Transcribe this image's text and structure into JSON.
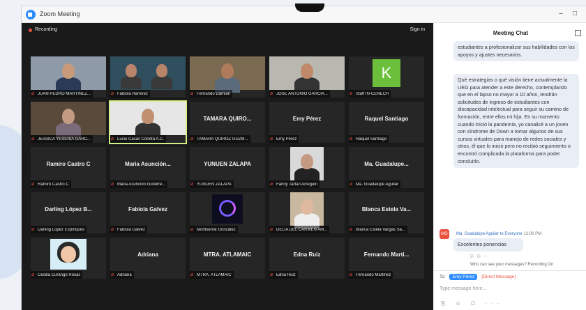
{
  "window": {
    "title": "Zoom Meeting",
    "minimize": "–",
    "maximize": "□"
  },
  "video": {
    "recording": "Recording",
    "sign_in": "Sign in"
  },
  "tiles": [
    {
      "label": "JUAN PEDRO MARTÍNEZ...",
      "kind": "photo",
      "skin": "#c99a7a",
      "bg": "#8e9aa8",
      "shirt": "#2b3a55"
    },
    {
      "label": "Fabiola Ramírez",
      "kind": "photo2",
      "skin": "#b9856a",
      "bg": "#2f4f5f",
      "shirt": "#3a3a3a"
    },
    {
      "label": "Fernando Damian",
      "kind": "photo",
      "skin": "#b07a5c",
      "bg": "#7a6a52",
      "shirt": "#5b6b7b"
    },
    {
      "label": "JOSE ANTONIO GARCÍA...",
      "kind": "photo",
      "skin": "#c08a6a",
      "bg": "#b8b8b0",
      "shirt": "#333"
    },
    {
      "label": "Staff IN-CENECH",
      "kind": "letter",
      "letter": "K"
    },
    {
      "label": "JESSICA YESENIA GARC...",
      "kind": "photo",
      "skin": "#c49a82",
      "bg": "#5a4a3a",
      "shirt": "#7a6a7a"
    },
    {
      "label": "Lucio Casas Coneta A.C.",
      "kind": "photo",
      "skin": "#c09070",
      "bg": "#e6e6e6",
      "shirt": "#333",
      "active": true
    },
    {
      "label": "TAMARA QUIROZ GUZM...",
      "kind": "name",
      "name": "TAMARA QUIRO..."
    },
    {
      "label": "Emy Pérez",
      "kind": "name",
      "name": "Emy Pérez"
    },
    {
      "label": "Raquel Santiago",
      "kind": "name",
      "name": "Raquel Santiago"
    },
    {
      "label": "Ramiro Castro C",
      "kind": "name",
      "name": "Ramiro Castro C"
    },
    {
      "label": "Maria Asunción Gutiérre...",
      "kind": "name",
      "name": "Maria Asunción..."
    },
    {
      "label": "YUNUEN ZALAPA",
      "kind": "name",
      "name": "YUNUEN ZALAPA"
    },
    {
      "label": "Fanny Tarfan Arreguin",
      "kind": "photo-small",
      "skin": "#c49a82",
      "bg": "#d9d9d9",
      "shirt": "#222"
    },
    {
      "label": "Ma. Guadalupe Aguilar",
      "kind": "name",
      "name": "Ma. Guadalupe..."
    },
    {
      "label": "Darling López Espíriques",
      "kind": "name",
      "name": "Darling López B..."
    },
    {
      "label": "Fabiola Galvez",
      "kind": "name",
      "name": "Fabiola Galvez"
    },
    {
      "label": "Montserrat González",
      "kind": "logo"
    },
    {
      "label": "DELIA DEL CARMEN AM...",
      "kind": "photo-small",
      "skin": "#e0b8a0",
      "bg": "#c8b8a0",
      "shirt": "#eeeeee"
    },
    {
      "label": "Blanca Estela Vargas Sa...",
      "kind": "name",
      "name": "Blanca Estela Va..."
    },
    {
      "label": "Cecilia Curangó Rosas",
      "kind": "cartoon"
    },
    {
      "label": "Adriana",
      "kind": "name",
      "name": "Adriana"
    },
    {
      "label": "MTRA. ATLAMAIC",
      "kind": "name",
      "name": "MTRA. ATLAMAIC"
    },
    {
      "label": "Edna Ruiz",
      "kind": "name",
      "name": "Edna Ruiz"
    },
    {
      "label": "Fernando Martinez",
      "kind": "name",
      "name": "Fernando Marti..."
    }
  ],
  "chat": {
    "title": "Meeting Chat",
    "message1": "estudiantes a profesionalizar sus habilidades con los apoyos y ajustes necesarios.",
    "message2": "Qué estrategias o qué visión tiene actualmente la UEG para atender a este derecho, contemplando que en el lapso no mayor a 10 años, tendrán solicitudes de ingreso de estudiantes con discapacidad intelectual para seguir su camino de formación, entre ellos mi hija. En su momento cuando inició la pandemia, yo canalicé a un joven con síndrome de Down a tomar algunos de sus cursos virtuales para manejo de redes sociales y otros, él que lo inició pero no recibió seguimiento o encontró complicada la plataforma para poder concluirlo.",
    "sender": "Ma. Guadalupe Aguilar",
    "to_word": "to",
    "audience": "Everyone",
    "time": "12:06 PM",
    "avatar_initials": "MG",
    "message3": "Excelentes ponencias",
    "reactions": "☺ ☺ ···",
    "tip": "Who can see your messages? Recording On",
    "to_label": "To:",
    "to_recipient": "Emy Pérez",
    "direct": "(Direct Message)",
    "input_placeholder": "Type message here...",
    "tools": "⎘ ☺ ▢ ···"
  }
}
